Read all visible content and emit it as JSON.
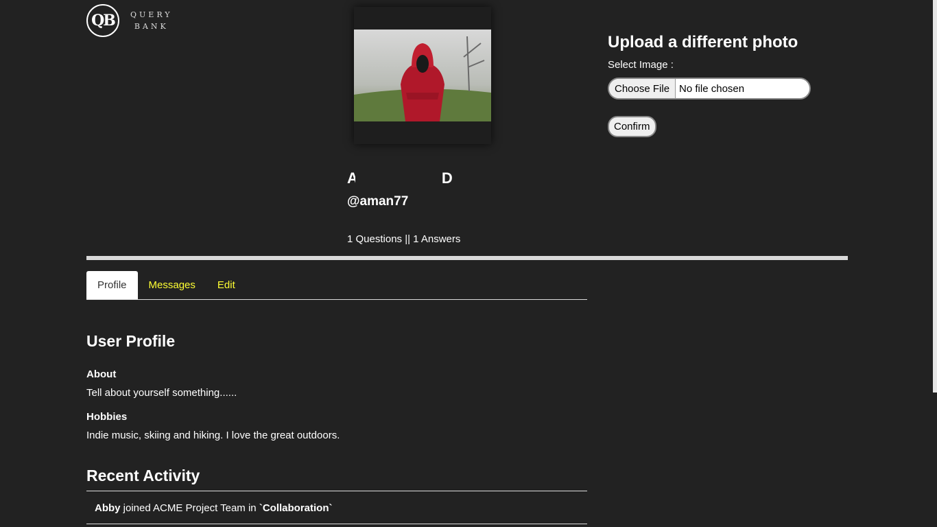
{
  "logo": {
    "monogram": "QB",
    "line1": "QUERY",
    "line2": "BANK"
  },
  "profile": {
    "name_start": "A",
    "name_end": "D",
    "handle": "@aman77",
    "stats": "1 Questions || 1 Answers"
  },
  "upload": {
    "title": "Upload a different photo",
    "select_label": "Select Image :",
    "choose_button": "Choose File",
    "file_status": "No file chosen",
    "confirm_button": "Confirm"
  },
  "tabs": [
    {
      "label": "Profile",
      "active": true
    },
    {
      "label": "Messages",
      "active": false
    },
    {
      "label": "Edit",
      "active": false
    }
  ],
  "user_profile": {
    "heading": "User Profile",
    "about_label": "About",
    "about_value": "Tell about yourself something......",
    "hobbies_label": "Hobbies",
    "hobbies_value": "Indie music, skiing and hiking. I love the great outdoors."
  },
  "recent_activity": {
    "heading": "Recent Activity",
    "items": [
      {
        "user": "Abby",
        "action": " joined ACME Project Team in ",
        "target": "`Collaboration`"
      }
    ]
  },
  "colors": {
    "background": "#222222",
    "tab_link": "#ffff33",
    "divider": "#d9d9d9"
  }
}
